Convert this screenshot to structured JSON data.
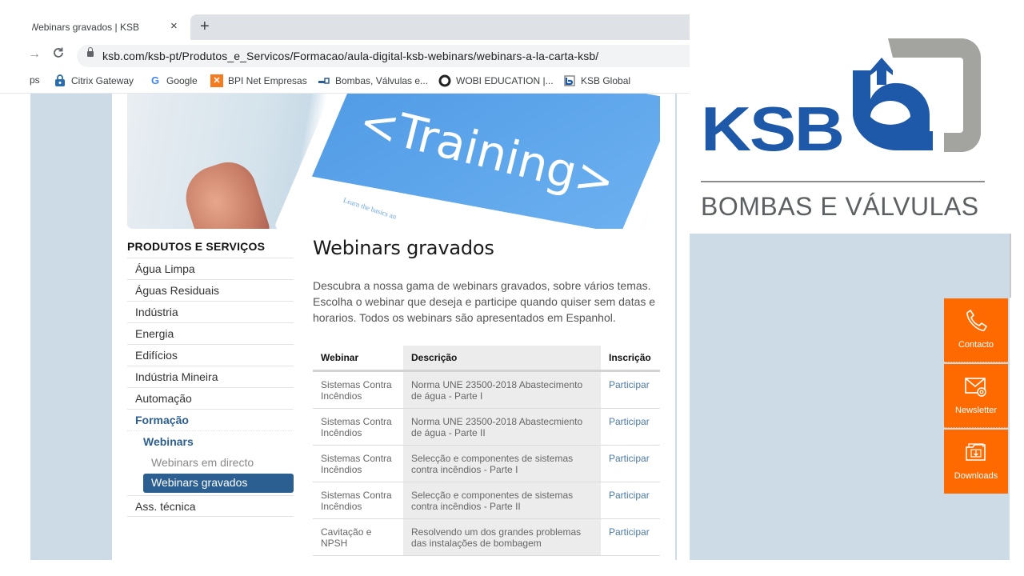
{
  "browser": {
    "tab_title": "Webinars gravados | KSB",
    "tab_close": "×",
    "new_tab": "+",
    "forward_glyph": "→",
    "reload_glyph": "C",
    "url": "ksb.com/ksb-pt/Produtos_e_Servicos/Formacao/aula-digital-ksb-webinars/webinars-a-la-carta-ksb/",
    "bookmarks": [
      {
        "label": "ps",
        "icon": "apps-icon"
      },
      {
        "label": "Citrix Gateway",
        "icon": "citrix-icon"
      },
      {
        "label": "Google",
        "icon": "google-icon"
      },
      {
        "label": "BPI Net Empresas",
        "icon": "bpi-icon"
      },
      {
        "label": "Bombas, Válvulas e...",
        "icon": "ksb-pump-icon"
      },
      {
        "label": "WOBI EDUCATION |...",
        "icon": "wobi-icon"
      },
      {
        "label": "KSB Global",
        "icon": "ksb-icon"
      }
    ]
  },
  "hero": {
    "text": "<Training>",
    "subtext": "Learn the basics an"
  },
  "sidebar": {
    "title": "PRODUTOS E SERVIÇOS",
    "items": [
      {
        "label": "Água Limpa"
      },
      {
        "label": "Águas Residuais"
      },
      {
        "label": "Indústria"
      },
      {
        "label": "Energia"
      },
      {
        "label": "Edifícios"
      },
      {
        "label": "Indústria Mineira"
      },
      {
        "label": "Automação"
      },
      {
        "label": "Formação"
      },
      {
        "label": "Webinars"
      },
      {
        "label": "Webinars em directo"
      },
      {
        "label": "Webinars gravados"
      },
      {
        "label": "Ass. técnica"
      }
    ]
  },
  "main": {
    "title": "Webinars gravados",
    "intro": "Descubra a nossa gama de webinars gravados, sobre vários temas. Escolha o webinar que deseja e participe quando quiser sem datas e horarios. Todos os webinars são apresentados em Espanhol.",
    "table": {
      "headers": [
        "Webinar",
        "Descrição",
        "Inscrição"
      ],
      "rows": [
        {
          "webinar": "Sistemas Contra Incêndios",
          "descricao": "Norma UNE 23500-2018 Abastecimento de água - Parte I",
          "inscricao": "Participar"
        },
        {
          "webinar": "Sistemas Contra Incêndios",
          "descricao": "Norma UNE 23500-2018 Abastecmiento de água - Parte II",
          "inscricao": "Participar"
        },
        {
          "webinar": "Sistemas Contra Incêndios",
          "descricao": "Selecção e componentes de sistemas contra incêndios - Parte I",
          "inscricao": "Participar"
        },
        {
          "webinar": "Sistemas Contra Incêndios",
          "descricao": "Selecção e componentes de sistemas contra incêndios - Parte II",
          "inscricao": "Participar"
        },
        {
          "webinar": "Cavitação e NPSH",
          "descricao": "Resolvendo um dos grandes problemas das instalações de bombagem",
          "inscricao": "Participar"
        }
      ]
    }
  },
  "logo": {
    "brand": "KSB",
    "tagline": "BOMBAS E VÁLVULAS",
    "colors": {
      "blue": "#1e58a8",
      "gray": "#a3a3a0"
    }
  },
  "floating_actions": [
    {
      "label": "Contacto",
      "icon": "phone-icon"
    },
    {
      "label": "Newsletter",
      "icon": "envelope-icon"
    },
    {
      "label": "Downloads",
      "icon": "folder-download-icon"
    }
  ],
  "colors": {
    "accent_orange": "#ff6a00",
    "nav_selected": "#2b5f91",
    "link": "#4a7aa6",
    "page_bg": "#cddbe7"
  }
}
